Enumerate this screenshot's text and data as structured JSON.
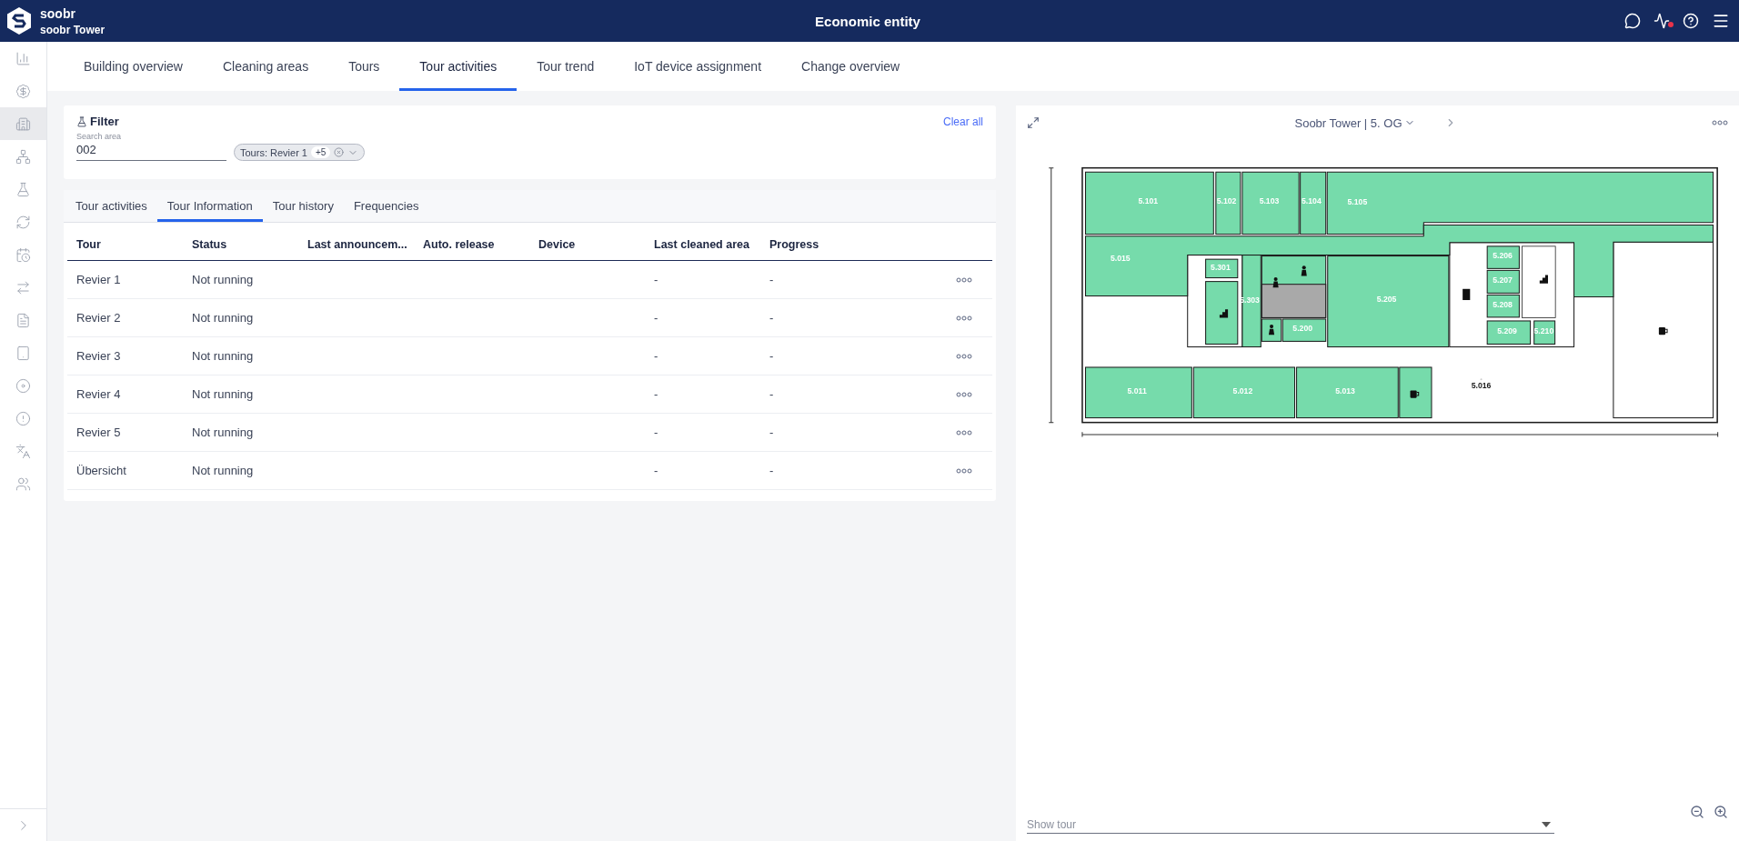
{
  "header": {
    "brand": "soobr",
    "building": "soobr Tower",
    "title": "Economic entity"
  },
  "sidebar": {
    "items": [
      {
        "selected": false
      },
      {
        "selected": false
      },
      {
        "selected": true
      },
      {
        "selected": false
      },
      {
        "selected": false
      },
      {
        "selected": false
      },
      {
        "selected": false
      },
      {
        "selected": false
      },
      {
        "selected": false
      },
      {
        "selected": false
      },
      {
        "selected": false
      },
      {
        "selected": false
      },
      {
        "selected": false
      },
      {
        "selected": false
      }
    ]
  },
  "nav_tabs": [
    {
      "label": "Building overview",
      "selected": false
    },
    {
      "label": "Cleaning areas",
      "selected": false
    },
    {
      "label": "Tours",
      "selected": false
    },
    {
      "label": "Tour activities",
      "selected": true
    },
    {
      "label": "Tour trend",
      "selected": false
    },
    {
      "label": "IoT device assignment",
      "selected": false
    },
    {
      "label": "Change overview",
      "selected": false
    }
  ],
  "filter": {
    "title": "Filter",
    "clear": "Clear all",
    "search": {
      "label": "Search area",
      "value": "002"
    },
    "chip": {
      "label": "Tours: Revier 1",
      "count": "+5"
    }
  },
  "sub_tabs": [
    {
      "label": "Tour activities",
      "selected": false
    },
    {
      "label": "Tour Information",
      "selected": true
    },
    {
      "label": "Tour history",
      "selected": false
    },
    {
      "label": "Frequencies",
      "selected": false
    }
  ],
  "table": {
    "columns": [
      "Tour",
      "Status",
      "Last announcem...",
      "Auto. release",
      "Device",
      "Last cleaned area",
      "Progress"
    ],
    "rows": [
      [
        "Revier 1",
        "Not running",
        "",
        "",
        "",
        "-",
        "-"
      ],
      [
        "Revier 2",
        "Not running",
        "",
        "",
        "",
        "-",
        "-"
      ],
      [
        "Revier 3",
        "Not running",
        "",
        "",
        "",
        "-",
        "-"
      ],
      [
        "Revier 4",
        "Not running",
        "",
        "",
        "",
        "-",
        "-"
      ],
      [
        "Revier 5",
        "Not running",
        "",
        "",
        "",
        "-",
        "-"
      ],
      [
        "Übersicht",
        "Not running",
        "",
        "",
        "",
        "-",
        "-"
      ]
    ]
  },
  "map": {
    "floor": "Soobr Tower | 5. OG",
    "show_tour": {
      "placeholder": "Show tour"
    },
    "rooms": [
      {
        "label": "5.101",
        "highlighted": true
      },
      {
        "label": "5.102",
        "highlighted": true
      },
      {
        "label": "5.103",
        "highlighted": true
      },
      {
        "label": "5.104",
        "highlighted": true
      },
      {
        "label": "5.105",
        "highlighted": true
      },
      {
        "label": "5.015",
        "highlighted": true
      },
      {
        "label": "5.301",
        "highlighted": true
      },
      {
        "label": "5.303",
        "highlighted": true
      },
      {
        "label": "5.200",
        "highlighted": true
      },
      {
        "label": "5.205",
        "highlighted": true
      },
      {
        "label": "5.206",
        "highlighted": true
      },
      {
        "label": "5.207",
        "highlighted": true
      },
      {
        "label": "5.208",
        "highlighted": true
      },
      {
        "label": "5.209",
        "highlighted": true
      },
      {
        "label": "5.210",
        "highlighted": true
      },
      {
        "label": "5.011",
        "highlighted": true
      },
      {
        "label": "5.012",
        "highlighted": true
      },
      {
        "label": "5.013",
        "highlighted": true
      },
      {
        "label": "5.016",
        "highlighted": false
      }
    ]
  }
}
